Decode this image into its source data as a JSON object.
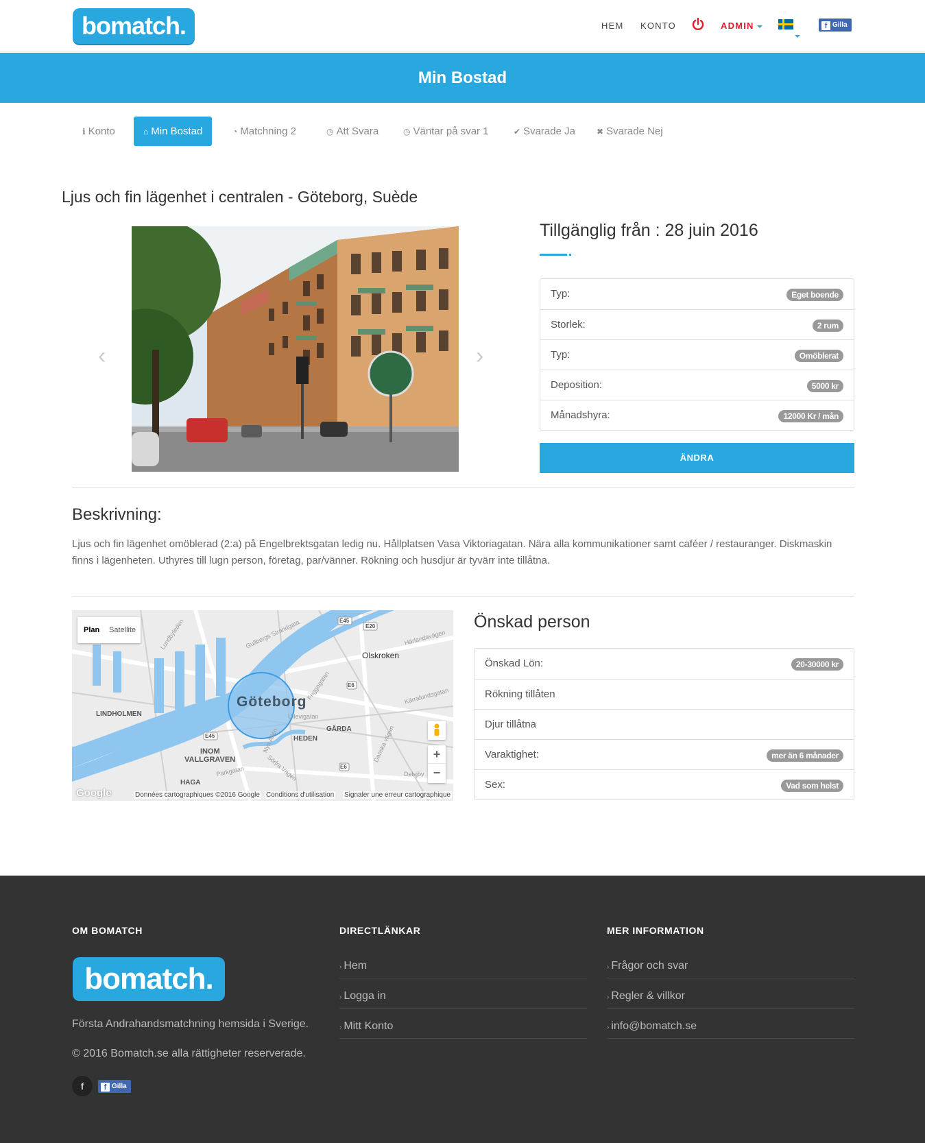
{
  "header": {
    "logo": "bomatch.",
    "nav": {
      "home": "HEM",
      "account": "KONTO",
      "admin": "ADMIN"
    },
    "fb_like": "Gilla"
  },
  "banner": {
    "title": "Min Bostad"
  },
  "tabs": [
    {
      "icon": "info-icon",
      "glyph": "ℹ",
      "label": "Konto"
    },
    {
      "icon": "home-icon",
      "glyph": "⌂",
      "label": "Min Bostad"
    },
    {
      "icon": "dashboard-icon",
      "glyph": "◔",
      "label": "Matchning 2"
    },
    {
      "icon": "clock-icon",
      "glyph": "◷",
      "label": "Att Svara"
    },
    {
      "icon": "clock-icon",
      "glyph": "◷",
      "label": "Väntar på svar 1"
    },
    {
      "icon": "check-circle-icon",
      "glyph": "✔",
      "label": "Svarade Ja"
    },
    {
      "icon": "times-circle-icon",
      "glyph": "✖",
      "label": "Svarade Nej"
    }
  ],
  "listing": {
    "title": "Ljus och fin lägenhet i centralen - Göteborg, Suède",
    "available": "Tillgänglig från : 28 juin 2016",
    "props": [
      {
        "label": "Typ:",
        "value": "Eget boende"
      },
      {
        "label": "Storlek:",
        "value": "2 rum"
      },
      {
        "label": "Typ:",
        "value": "Omöblerat"
      },
      {
        "label": "Deposition:",
        "value": "5000 kr"
      },
      {
        "label": "Månadshyra:",
        "value": "12000 Kr / mån"
      }
    ],
    "edit_button": "ÄNDRA"
  },
  "description": {
    "title": "Beskrivning:",
    "text": "Ljus och fin lägenhet omöblerad (2:a) på Engelbrektsgatan ledig nu. Hållplatsen Vasa Viktoriagatan. Nära alla kommunikationer samt caféer / restauranger. Diskmaskin finns i lägenheten. Uthyres till lugn person, företag, par/vänner. Rökning och husdjur är tyvärr inte tillåtna."
  },
  "map": {
    "type_plan": "Plan",
    "type_satellite": "Satellite",
    "city": "Göteborg",
    "labels": {
      "olskroken": "Olskroken",
      "lindholmen": "LINDHOLMEN",
      "garda": "GÅRDA",
      "heden": "HEDEN",
      "inom": "INOM",
      "vallgraven": "VALLGRAVEN",
      "haga": "HAGA",
      "e45a": "E45",
      "e45b": "E45",
      "e20": "E20",
      "e6a": "E6",
      "e6b": "E6",
      "gullbergs": "Gullbergs Strandgata",
      "harlanda": "Härlandavägen",
      "friggagatan": "Friggagatan",
      "ullevigatan": "Ullevigatan",
      "karralunds": "Kärralundsgatan",
      "danska": "Danska vägen",
      "sodra": "Södra Vägen",
      "parkgatan": "Parkgatan",
      "lundbyleden": "Lundbyleden",
      "delsjov": "Delsjöv",
      "nya_allen": "Nya Allén"
    },
    "zoom_in": "+",
    "zoom_out": "−",
    "google": "Google",
    "footer_data": "Données cartographiques ©2016 Google",
    "footer_terms": "Conditions d'utilisation",
    "footer_report": "Signaler une erreur cartographique"
  },
  "person": {
    "title": "Önskad person",
    "props": [
      {
        "label": "Önskad Lön:",
        "value": "20-30000 kr"
      },
      {
        "label": "Rökning tillåten",
        "value": ""
      },
      {
        "label": "Djur tillåtna",
        "value": ""
      },
      {
        "label": "Varaktighet:",
        "value": "mer än 6 månader"
      },
      {
        "label": "Sex:",
        "value": "Vad som helst"
      }
    ]
  },
  "footer": {
    "col1": {
      "title": "OM BOMATCH",
      "logo": "bomatch.",
      "tagline": "Första Andrahandsmatchning hemsida i Sverige.",
      "copyright": "© 2016 Bomatch.se alla rättigheter reserverade.",
      "fb_like": "Gilla"
    },
    "col2": {
      "title": "DIRECTLÄNKAR",
      "links": [
        "Hem",
        "Logga in",
        "Mitt Konto"
      ]
    },
    "col3": {
      "title": "MER INFORMATION",
      "links": [
        "Frågor och svar",
        "Regler & villkor",
        "info@bomatch.se"
      ]
    }
  },
  "colors": {
    "brand": "#29a8e0",
    "admin": "#e8172c",
    "footer_bg": "#333333",
    "badge": "#999999"
  }
}
